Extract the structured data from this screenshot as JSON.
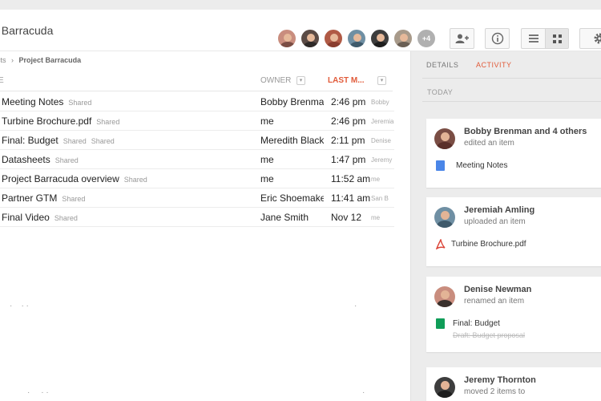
{
  "header": {
    "title": "t Barracuda",
    "more_count": "+4"
  },
  "colors": {
    "accent": "#e15b3a",
    "doc": "#4a86e8",
    "pdf": "#db4437",
    "sheet": "#0f9d58"
  },
  "breadcrumb": {
    "parent": "cts",
    "separator": "›",
    "current": "Project Barracuda"
  },
  "columns": {
    "name": "E",
    "owner": "OWNER",
    "modified": "LAST M..."
  },
  "files": [
    {
      "name": "Meeting Notes",
      "shared": "Shared",
      "shared2": "",
      "owner": "Bobby Brenman",
      "modified": "2:46 pm",
      "by": "Bobby"
    },
    {
      "name": "Turbine Brochure.pdf",
      "shared": "Shared",
      "shared2": "",
      "owner": "me",
      "modified": "2:46 pm",
      "by": "Jeremiah"
    },
    {
      "name": "Final: Budget",
      "shared": "Shared",
      "shared2": "Shared",
      "owner": "Meredith Black",
      "modified": "2:11 pm",
      "by": "Denise"
    },
    {
      "name": "Datasheets",
      "shared": "Shared",
      "shared2": "",
      "owner": "me",
      "modified": "1:47 pm",
      "by": "Jeremy"
    },
    {
      "name": "Project Barracuda overview",
      "shared": "Shared",
      "shared2": "",
      "owner": "me",
      "modified": "11:52 am",
      "by": "me"
    },
    {
      "name": "Partner GTM",
      "shared": "Shared",
      "shared2": "",
      "owner": "Eric Shoemaker",
      "modified": "11:41 am",
      "by": "San B"
    },
    {
      "name": "Final Video",
      "shared": "Shared",
      "shared2": "",
      "owner": "Jane Smith",
      "modified": "Nov 12",
      "by": "me"
    }
  ],
  "panel": {
    "tabs": {
      "details": "DETAILS",
      "activity": "ACTIVITY"
    },
    "today": "TODAY",
    "cards": [
      {
        "who": "Bobby Brenman and 4 others",
        "action": "edited an item",
        "item": "Meeting Notes",
        "item_icon": "doc-icon",
        "old": ""
      },
      {
        "who": "Jeremiah Amling",
        "action": "uploaded an item",
        "item": "Turbine Brochure.pdf",
        "item_icon": "pdf-icon",
        "old": ""
      },
      {
        "who": "Denise Newman",
        "action": "renamed an item",
        "item": "Final: Budget",
        "item_icon": "sheet-icon",
        "old": "Draft: Budget proposal"
      },
      {
        "who": "Jeremy Thornton",
        "action": "moved 2 items to",
        "item": "",
        "item_icon": "",
        "old": ""
      }
    ]
  }
}
